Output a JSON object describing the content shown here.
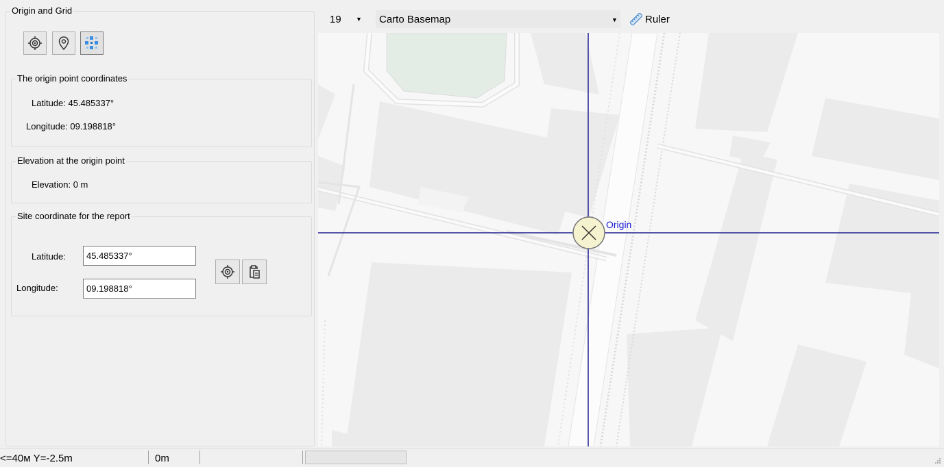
{
  "panel": {
    "title": "Origin and Grid",
    "tool_icons": [
      "target-icon",
      "location-pin-icon",
      "grid-cells-icon"
    ],
    "origin_group": {
      "title": "The origin point coordinates",
      "latitude_text": "Latitude: 45.485337°",
      "longitude_text": "Longitude: 09.198818°"
    },
    "elevation_group": {
      "title": "Elevation at the origin point",
      "elevation_text": "Elevation: 0 m"
    },
    "site_group": {
      "title": "Site coordinate for the report",
      "latitude_label": "Latitude:",
      "latitude_value": "45.485337°",
      "longitude_label": "Longitude:",
      "longitude_value": "09.198818°",
      "action_icons": [
        "target-icon",
        "clipboard-paste-icon"
      ]
    }
  },
  "map_toolbar": {
    "zoom_level": "19",
    "basemap": "Carto Basemap",
    "ruler_label": "Ruler"
  },
  "map": {
    "origin_label": "Origin",
    "crosshair_color": "#1f1f8f",
    "origin_label_color": "#1c1cd6"
  },
  "statusbar": {
    "coords": "<=40м  Y=-2.5m",
    "distance": "0m"
  }
}
